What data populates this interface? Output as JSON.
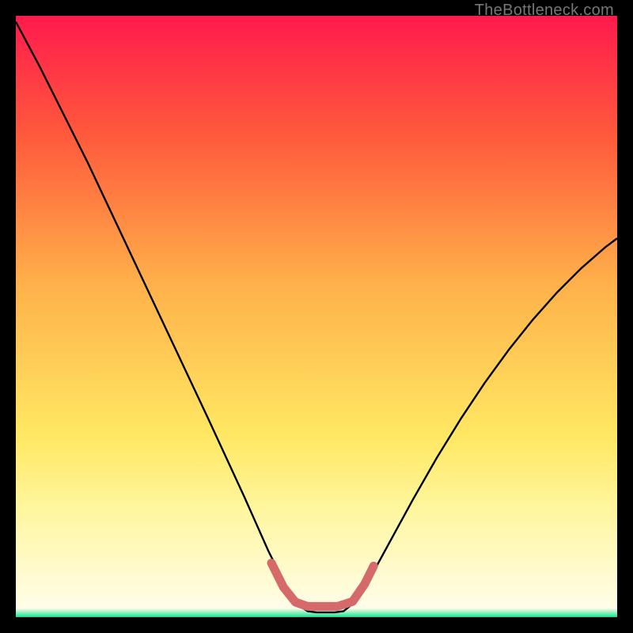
{
  "watermark": "TheBottleneck.com",
  "chart_data": {
    "type": "line",
    "title": "",
    "xlabel": "",
    "ylabel": "",
    "xlim": [
      0,
      100
    ],
    "ylim": [
      0,
      100
    ],
    "gradient_stops": [
      {
        "offset": 0.0,
        "color": "#ff1a4d"
      },
      {
        "offset": 0.2,
        "color": "#ff5a3c"
      },
      {
        "offset": 0.45,
        "color": "#ffb24a"
      },
      {
        "offset": 0.7,
        "color": "#ffe863"
      },
      {
        "offset": 0.82,
        "color": "#fff69e"
      },
      {
        "offset": 0.985,
        "color": "#fffde9"
      },
      {
        "offset": 0.998,
        "color": "#35e79d"
      },
      {
        "offset": 1.0,
        "color": "#00d884"
      }
    ],
    "series": [
      {
        "name": "bottleneck-curve",
        "stroke": "#000000",
        "stroke_width": 2.4,
        "points": [
          {
            "x": 0.0,
            "y": 99.0
          },
          {
            "x": 4.0,
            "y": 91.5
          },
          {
            "x": 8.0,
            "y": 83.5
          },
          {
            "x": 12.0,
            "y": 75.5
          },
          {
            "x": 16.0,
            "y": 67.0
          },
          {
            "x": 20.0,
            "y": 58.5
          },
          {
            "x": 24.0,
            "y": 50.0
          },
          {
            "x": 28.0,
            "y": 41.5
          },
          {
            "x": 32.0,
            "y": 33.0
          },
          {
            "x": 35.0,
            "y": 26.5
          },
          {
            "x": 38.0,
            "y": 20.0
          },
          {
            "x": 40.0,
            "y": 15.5
          },
          {
            "x": 42.0,
            "y": 11.0
          },
          {
            "x": 44.0,
            "y": 7.0
          },
          {
            "x": 45.5,
            "y": 4.0
          },
          {
            "x": 47.0,
            "y": 2.0
          },
          {
            "x": 48.5,
            "y": 1.0
          },
          {
            "x": 50.0,
            "y": 0.8
          },
          {
            "x": 51.5,
            "y": 0.8
          },
          {
            "x": 53.0,
            "y": 0.8
          },
          {
            "x": 54.5,
            "y": 1.0
          },
          {
            "x": 56.0,
            "y": 2.2
          },
          {
            "x": 58.0,
            "y": 5.0
          },
          {
            "x": 60.0,
            "y": 8.5
          },
          {
            "x": 63.0,
            "y": 14.0
          },
          {
            "x": 66.0,
            "y": 19.5
          },
          {
            "x": 70.0,
            "y": 26.5
          },
          {
            "x": 74.0,
            "y": 33.0
          },
          {
            "x": 78.0,
            "y": 39.0
          },
          {
            "x": 82.0,
            "y": 44.5
          },
          {
            "x": 86.0,
            "y": 49.5
          },
          {
            "x": 90.0,
            "y": 54.0
          },
          {
            "x": 94.0,
            "y": 58.0
          },
          {
            "x": 98.0,
            "y": 61.5
          },
          {
            "x": 100.0,
            "y": 63.0
          }
        ]
      },
      {
        "name": "optimal-underline",
        "stroke": "#d66a6a",
        "stroke_width": 11,
        "linecap": "round",
        "points": [
          {
            "x": 42.5,
            "y": 9.0
          },
          {
            "x": 44.5,
            "y": 5.0
          },
          {
            "x": 46.5,
            "y": 2.5
          },
          {
            "x": 48.5,
            "y": 1.8
          },
          {
            "x": 51.0,
            "y": 1.8
          },
          {
            "x": 53.5,
            "y": 1.8
          },
          {
            "x": 56.0,
            "y": 2.6
          },
          {
            "x": 58.0,
            "y": 5.5
          },
          {
            "x": 59.5,
            "y": 8.5
          }
        ]
      }
    ]
  }
}
